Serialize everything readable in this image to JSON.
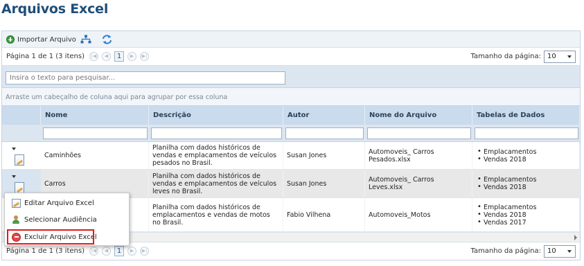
{
  "page": {
    "title": "Arquivos Excel"
  },
  "toolbar": {
    "import_label": "Importar Arquivo",
    "icons": [
      "add-icon",
      "hierarchy-icon",
      "refresh-icon"
    ]
  },
  "pager": {
    "info": "Página 1 de 1 (3 itens)",
    "current_page": "1",
    "page_size_label": "Tamanho da página:",
    "page_size": "10"
  },
  "search": {
    "placeholder": "Insira o texto para pesquisar..."
  },
  "group_hint": "Arraste um cabeçalho de coluna aqui para agrupar por essa coluna",
  "columns": [
    "Nome",
    "Descrição",
    "Autor",
    "Nome do Arquivo",
    "Tabelas de Dados"
  ],
  "rows": [
    {
      "nome": "Caminhões",
      "descricao": "Planilha com dados históricos de vendas e emplacamentos de veículos pesados no Brasil.",
      "autor": "Susan Jones",
      "arquivo": "Automoveis_ Carros Pesados.xlsx",
      "tabelas": [
        "Emplacamentos",
        "Vendas 2018"
      ]
    },
    {
      "nome": "Carros",
      "descricao": "Planilha com dados históricos de vendas e emplacamentos de veículos leves no Brasil.",
      "autor": "Susan Jones",
      "arquivo": "Automoveis_ Carros Leves.xlsx",
      "tabelas": [
        "Emplacamentos",
        "Vendas 2018"
      ]
    },
    {
      "nome": "",
      "descricao": "Planilha com dados históricos de emplacamentos e vendas de motos no Brasil.",
      "autor": "Fabio Vilhena",
      "arquivo": "Automoveis_Motos",
      "tabelas": [
        "Emplacamentos",
        "Vendas 2018",
        "Vendas 2017"
      ]
    }
  ],
  "context_menu": {
    "items": [
      {
        "label": "Editar Arquivo Excel",
        "icon": "edit-icon"
      },
      {
        "label": "Selecionar Audiência",
        "icon": "users-icon"
      },
      {
        "label": "Excluir Arquivo Excel",
        "icon": "delete-icon"
      }
    ],
    "highlight_color": "#e01b1b"
  },
  "colors": {
    "title": "#1f4e79",
    "header_bg": "#c9dbed",
    "selected_row": "#e8e8e8"
  }
}
